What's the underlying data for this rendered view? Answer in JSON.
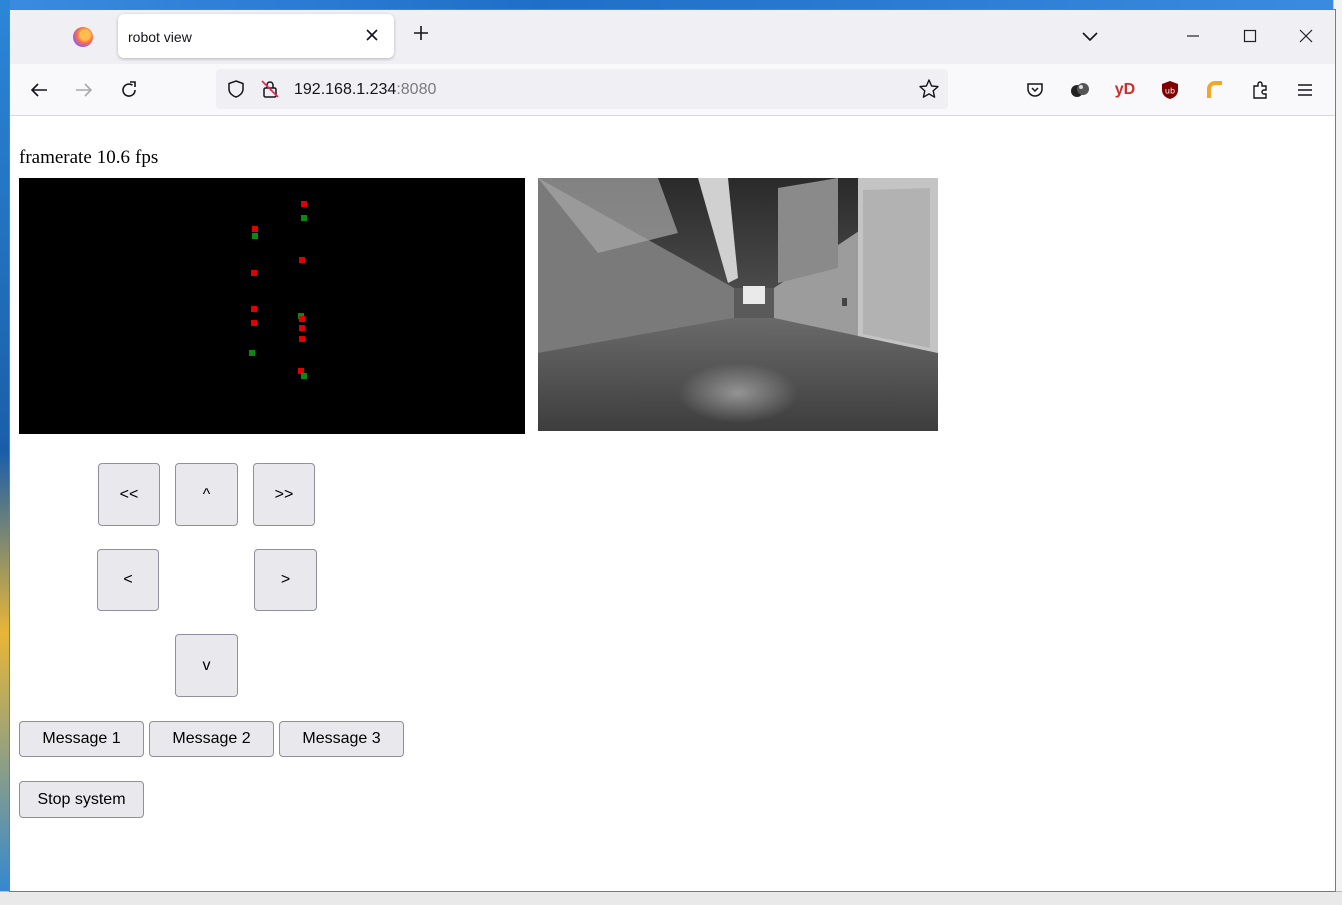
{
  "browser": {
    "tab_title": "robot view",
    "url_host": "192.168.1.234",
    "url_port": ":8080"
  },
  "extensions": {
    "yd_label": "yD"
  },
  "page": {
    "framerate_label": "framerate",
    "framerate_value": "10.6",
    "framerate_unit": "fps"
  },
  "controls": {
    "fast_left": "<<",
    "forward": "^",
    "fast_right": ">>",
    "left": "<",
    "right": ">",
    "back": "v"
  },
  "messages": [
    "Message 1",
    "Message 2",
    "Message 3"
  ],
  "stop_label": "Stop system",
  "colors": {
    "red_marker": "#e00000",
    "green_marker": "#0a8a0a"
  }
}
